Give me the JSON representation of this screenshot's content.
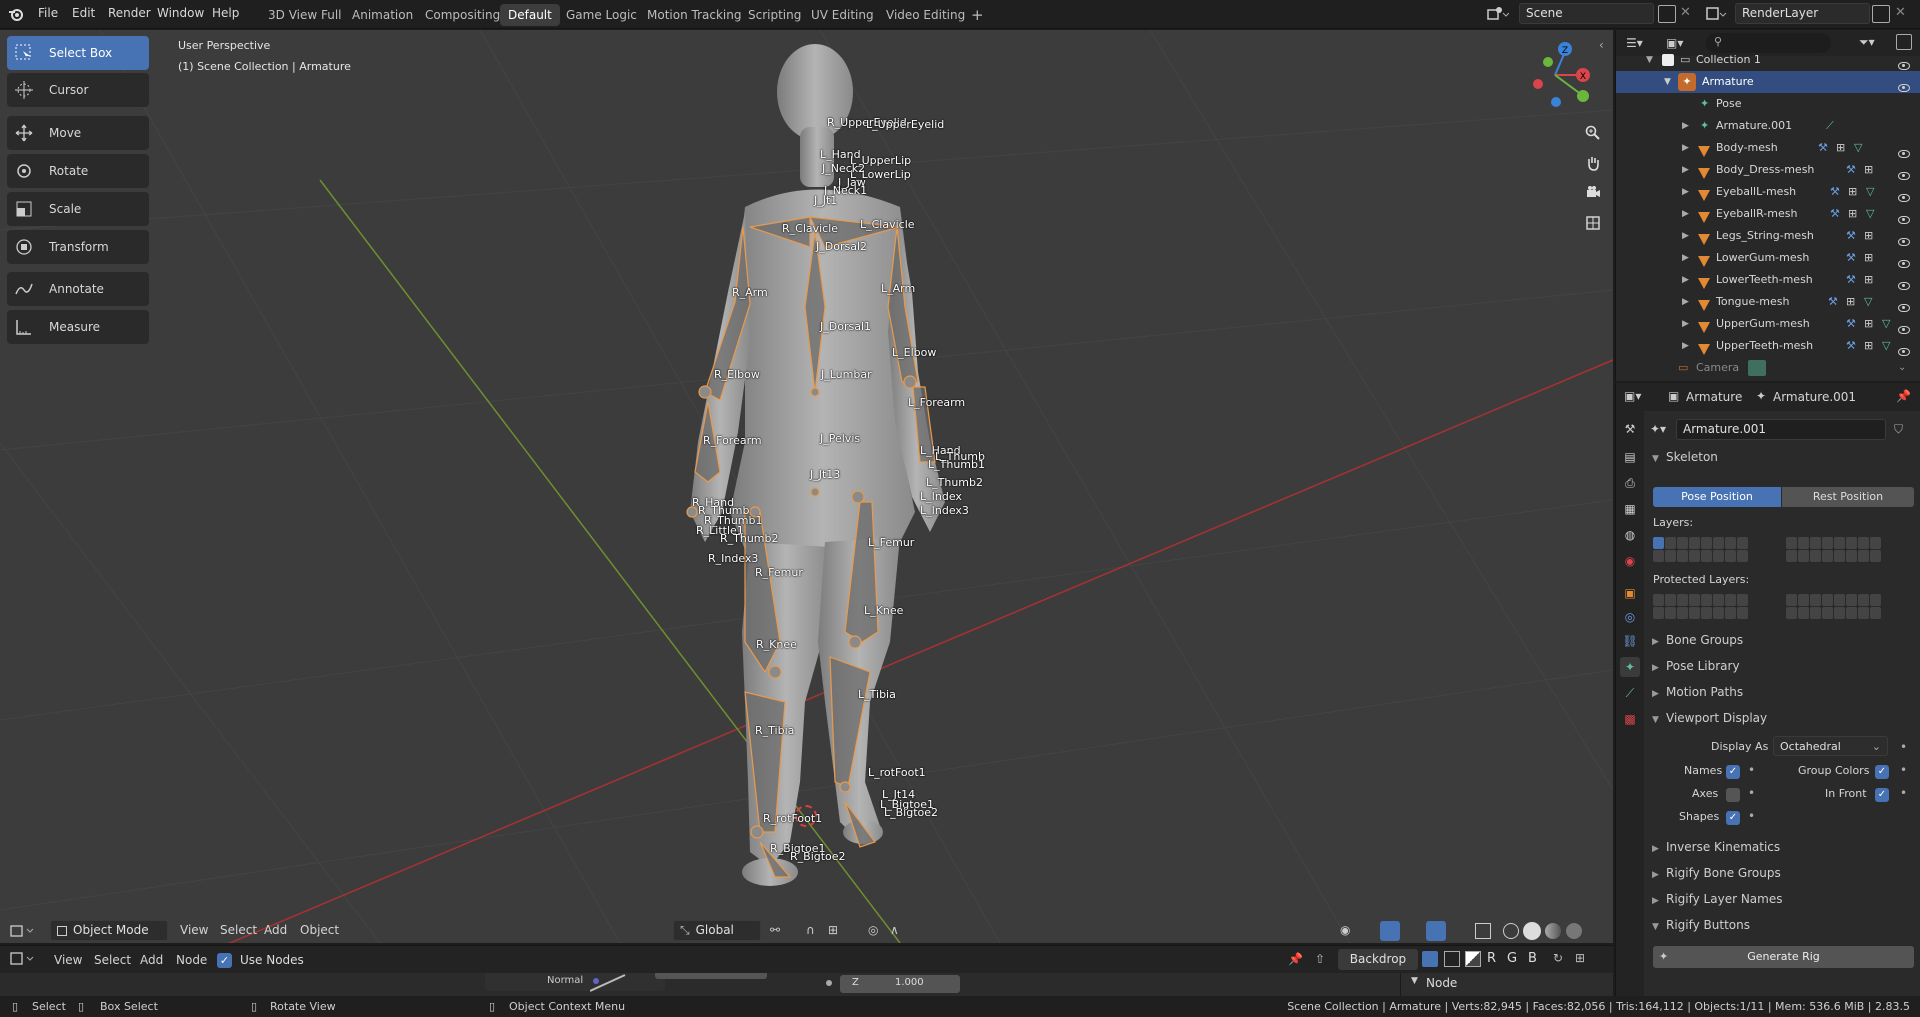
{
  "topbar": {
    "menus": [
      "File",
      "Edit",
      "Render",
      "Window",
      "Help"
    ],
    "workspaces": [
      "3D View Full",
      "Animation",
      "Compositing",
      "Default",
      "Game Logic",
      "Motion Tracking",
      "Scripting",
      "UV Editing",
      "Video Editing"
    ],
    "active_workspace": "Default",
    "add_tab": "+",
    "scene": "Scene",
    "view_layer": "RenderLayer"
  },
  "viewport": {
    "perspective": "User Perspective",
    "collection": "(1) Scene Collection | Armature",
    "tools": [
      {
        "label": "Select Box",
        "icon": "select-box-icon"
      },
      {
        "label": "Cursor",
        "icon": "cursor-icon"
      },
      {
        "label": "Move",
        "icon": "move-icon"
      },
      {
        "label": "Rotate",
        "icon": "rotate-icon"
      },
      {
        "label": "Scale",
        "icon": "scale-icon"
      },
      {
        "label": "Transform",
        "icon": "transform-icon"
      },
      {
        "label": "Annotate",
        "icon": "annotate-icon"
      },
      {
        "label": "Measure",
        "icon": "measure-icon"
      }
    ],
    "gizmo": {
      "x": "X",
      "y": "Y",
      "z": "Z"
    },
    "bones": [
      "R_UpperEyelid",
      "L_UpperEyelid",
      "L_Hand",
      "L_UpperLip",
      "L_LowerLip",
      "J_Neck2",
      "J_Jaw",
      "J_Neck1",
      "J_Jt1",
      "R_Clavicle",
      "L_Clavicle",
      "J_Dorsal2",
      "R_Arm",
      "L_Arm",
      "J_Dorsal1",
      "L_Elbow",
      "R_Elbow",
      "J_Lumbar",
      "L_Forearm",
      "R_Forearm",
      "J_Pelvis",
      "J_Jt13",
      "L_Hand",
      "L_Thumb",
      "L_Thumb1",
      "L_Thumb2",
      "L_Index",
      "L_Index3",
      "R_Hand",
      "R_Thumb",
      "R_Thumb1",
      "R_Little1",
      "R_Thumb2",
      "R_Index3",
      "R_Femur",
      "L_Femur",
      "L_Knee",
      "R_Knee",
      "L_Tibia",
      "R_Tibia",
      "L_rotFoot1",
      "L_Jt14",
      "L_Bigtoe1",
      "L_Bigtoe2",
      "R_rotFoot1",
      "R_Bigtoe1",
      "R_Bigtoe2"
    ],
    "header": {
      "mode": "Object Mode",
      "menus": [
        "View",
        "Select",
        "Add",
        "Object"
      ],
      "orientation": "Global"
    }
  },
  "node_editor": {
    "menus": [
      "View",
      "Select",
      "Add",
      "Node"
    ],
    "use_nodes_label": "Use Nodes",
    "backdrop": "Backdrop",
    "channels": [
      "R",
      "G",
      "B"
    ],
    "node_label": "Normal",
    "z_label": "Z",
    "z_value": "1.000",
    "panel": "Node"
  },
  "outliner": {
    "collection": "Collection 1",
    "items": [
      {
        "name": "Armature",
        "type": "armature",
        "selected": true,
        "depth": 1
      },
      {
        "name": "Pose",
        "type": "pose",
        "depth": 2
      },
      {
        "name": "Armature.001",
        "type": "armature-data",
        "depth": 2
      },
      {
        "name": "Body-mesh",
        "type": "mesh",
        "depth": 2
      },
      {
        "name": "Body_Dress-mesh",
        "type": "mesh",
        "depth": 2
      },
      {
        "name": "EyeballL-mesh",
        "type": "mesh",
        "depth": 2
      },
      {
        "name": "EyeballR-mesh",
        "type": "mesh",
        "depth": 2
      },
      {
        "name": "Legs_String-mesh",
        "type": "mesh",
        "depth": 2
      },
      {
        "name": "LowerGum-mesh",
        "type": "mesh",
        "depth": 2
      },
      {
        "name": "LowerTeeth-mesh",
        "type": "mesh",
        "depth": 2
      },
      {
        "name": "Tongue-mesh",
        "type": "mesh",
        "depth": 2
      },
      {
        "name": "UpperGum-mesh",
        "type": "mesh",
        "depth": 2
      },
      {
        "name": "UpperTeeth-mesh",
        "type": "mesh",
        "depth": 2
      },
      {
        "name": "Camera",
        "type": "camera",
        "depth": 1
      }
    ]
  },
  "properties": {
    "object": "Armature",
    "data": "Armature.001",
    "datablock": "Armature.001",
    "skeleton": "Skeleton",
    "pose_position": "Pose Position",
    "rest_position": "Rest Position",
    "layers": "Layers:",
    "protected_layers": "Protected Layers:",
    "sections": [
      "Bone Groups",
      "Pose Library",
      "Motion Paths"
    ],
    "viewport_display": "Viewport Display",
    "display_as_label": "Display As",
    "display_as_value": "Octahedral",
    "names": "Names",
    "axes": "Axes",
    "shapes": "Shapes",
    "group_colors": "Group Colors",
    "in_front": "In Front",
    "sections2": [
      "Inverse Kinematics",
      "Rigify Bone Groups",
      "Rigify Layer Names",
      "Rigify Buttons"
    ],
    "generate_rig": "Generate Rig"
  },
  "status": {
    "select": "Select",
    "box_select": "Box Select",
    "rotate_view": "Rotate View",
    "context_menu": "Object Context Menu",
    "stats": "Scene Collection | Armature | Verts:82,945 | Faces:82,056 | Tris:164,112 | Objects:1/11 | Mem: 536.6 MiB | 2.83.5"
  },
  "colors": {
    "accent": "#4772b3",
    "selection": "#334d80",
    "bone": "#e8a060",
    "x_axis": "#d9454a",
    "y_axis": "#6bb63c",
    "z_axis": "#3b83d9"
  }
}
